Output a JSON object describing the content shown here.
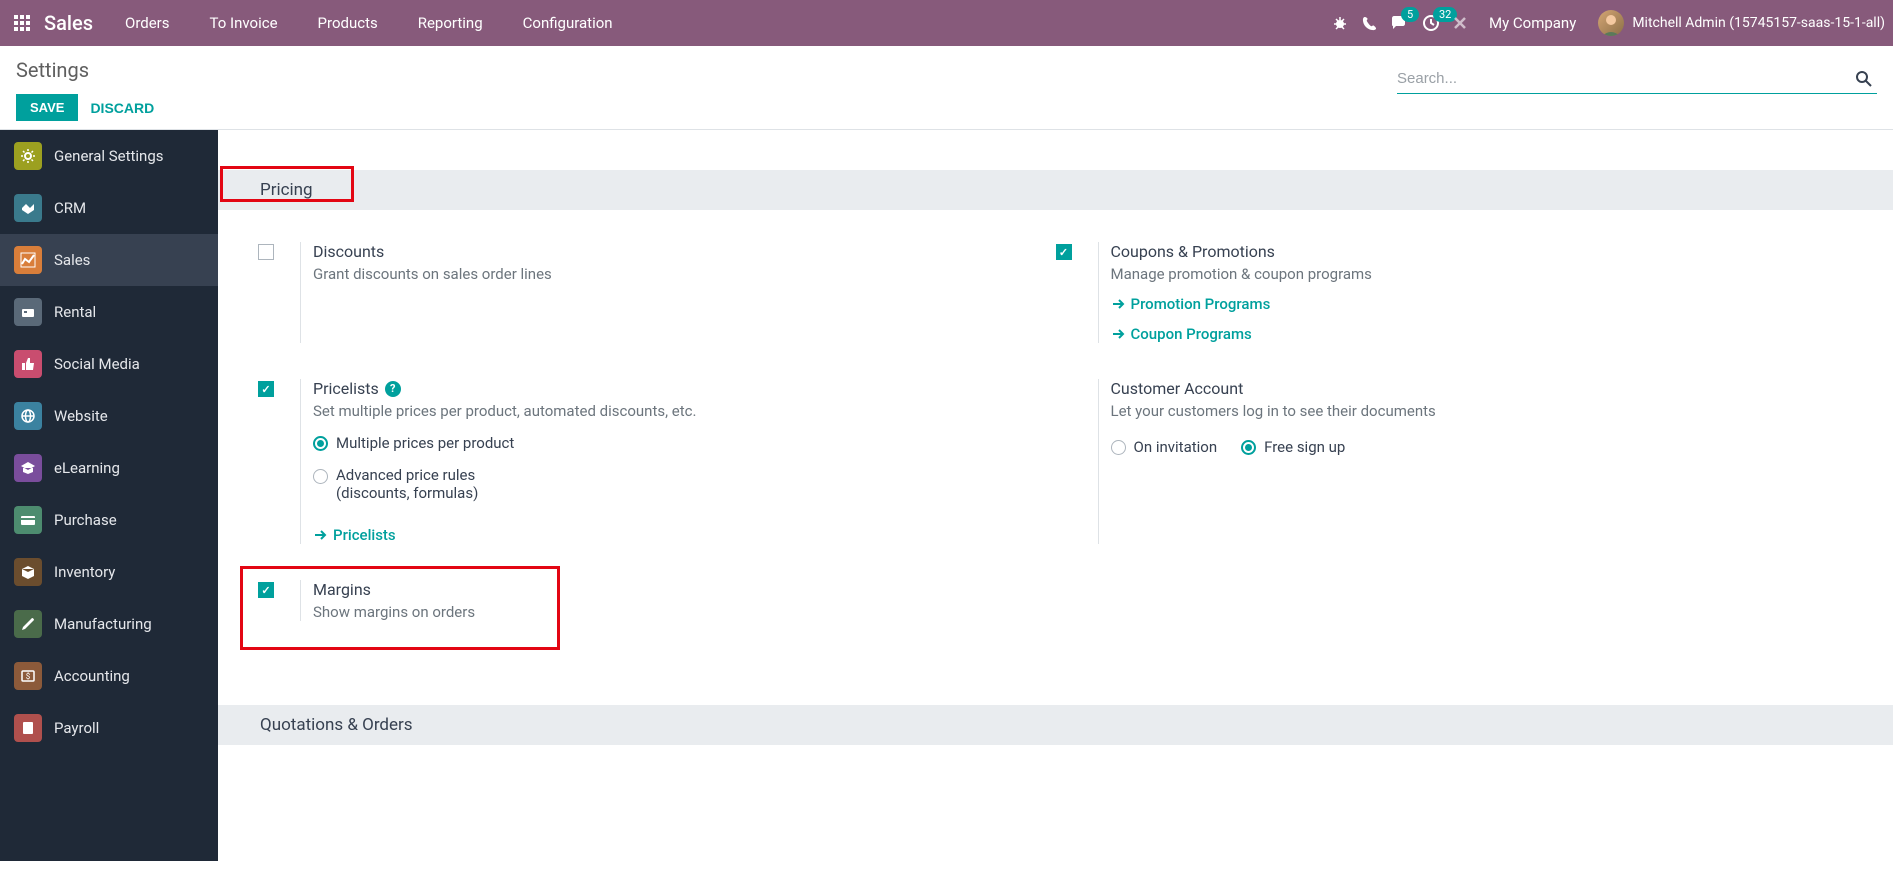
{
  "navbar": {
    "brand": "Sales",
    "menu": [
      "Orders",
      "To Invoice",
      "Products",
      "Reporting",
      "Configuration"
    ],
    "messages_badge": "5",
    "activities_badge": "32",
    "company": "My Company",
    "user": "Mitchell Admin (15745157-saas-15-1-all)"
  },
  "breadcrumb": "Settings",
  "buttons": {
    "save": "SAVE",
    "discard": "DISCARD"
  },
  "search": {
    "placeholder": "Search..."
  },
  "sidebar": {
    "items": [
      {
        "label": "General Settings"
      },
      {
        "label": "CRM"
      },
      {
        "label": "Sales"
      },
      {
        "label": "Rental"
      },
      {
        "label": "Social Media"
      },
      {
        "label": "Website"
      },
      {
        "label": "eLearning"
      },
      {
        "label": "Purchase"
      },
      {
        "label": "Inventory"
      },
      {
        "label": "Manufacturing"
      },
      {
        "label": "Accounting"
      },
      {
        "label": "Payroll"
      }
    ]
  },
  "sections": {
    "pricing": {
      "title": "Pricing",
      "discounts": {
        "title": "Discounts",
        "desc": "Grant discounts on sales order lines"
      },
      "coupons": {
        "title": "Coupons & Promotions",
        "desc": "Manage promotion & coupon programs",
        "link1": "Promotion Programs",
        "link2": "Coupon Programs"
      },
      "pricelists": {
        "title": "Pricelists",
        "desc": "Set multiple prices per product, automated discounts, etc.",
        "opt1": "Multiple prices per product",
        "opt2a": "Advanced price rules",
        "opt2b": "(discounts, formulas)",
        "link": "Pricelists"
      },
      "customer_account": {
        "title": "Customer Account",
        "desc": "Let your customers log in to see their documents",
        "opt1": "On invitation",
        "opt2": "Free sign up"
      },
      "margins": {
        "title": "Margins",
        "desc": "Show margins on orders"
      }
    },
    "quotations": {
      "title": "Quotations & Orders"
    }
  }
}
